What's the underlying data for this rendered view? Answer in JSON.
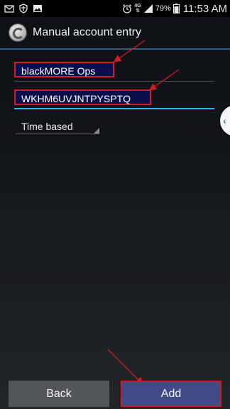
{
  "status_bar": {
    "network": "4G",
    "battery_percent": "79%",
    "time": "11:53 AM",
    "left_icons": [
      "mail-icon",
      "shield-icon",
      "image-icon"
    ],
    "right_icons": [
      "alarm-icon",
      "network-4g-icon",
      "signal-icon",
      "battery-icon"
    ]
  },
  "action_bar": {
    "title": "Manual account entry",
    "icon": "authenticator-app-icon"
  },
  "form": {
    "account_name": {
      "value": "blackMORE Ops",
      "highlighted": true
    },
    "secret_key": {
      "value": "WKHM6UVJNTPYSPTQ",
      "highlighted": true,
      "focused": true
    },
    "key_type": {
      "selected": "Time based"
    }
  },
  "side_tab": {
    "icon": "chevron-left-icon",
    "glyph": "‹"
  },
  "buttons": {
    "back_label": "Back",
    "add_label": "Add"
  },
  "colors": {
    "focus_underline": "#33b5e5",
    "highlight_border": "#d01c24",
    "highlight_fill": "#0d0f4a",
    "add_button": "#3f4a86",
    "back_button": "#525559"
  }
}
